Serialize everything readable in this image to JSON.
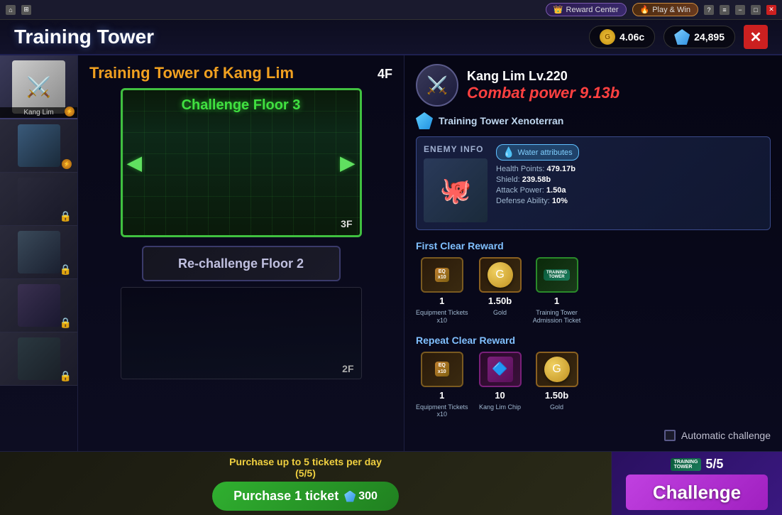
{
  "os_bar": {
    "buttons": [
      "home",
      "grid",
      "window"
    ],
    "reward_center": "Reward Center",
    "play_win": "Play & Win"
  },
  "header": {
    "title": "Training Tower",
    "currency_gold": "4.06c",
    "currency_gems": "24,895",
    "close_label": "✕"
  },
  "sidebar": {
    "hero_name": "Kang Lim"
  },
  "tower_panel": {
    "title": "Training Tower of Kang Lim",
    "floor_current": "4F",
    "challenge_floor_label": "Challenge Floor 3",
    "floor_3_label": "3F",
    "rechallenge_label": "Re-challenge Floor 2",
    "floor_2_label": "2F"
  },
  "right_panel": {
    "boss_name": "Kang Lim Lv.220",
    "combat_power": "Combat power 9.13b",
    "tower_name": "Training Tower Xenoterran",
    "enemy_info_title": "ENEMY INFO",
    "attribute": "Water attributes",
    "hp": "479.17b",
    "shield": "239.58b",
    "attack": "1.50a",
    "defense": "10%",
    "first_clear_title": "First Clear Reward",
    "repeat_clear_title": "Repeat Clear Reward",
    "rewards_first": [
      {
        "count": "1",
        "desc": "Equipment Tickets\nx10",
        "type": "equipment"
      },
      {
        "count": "1.50b",
        "desc": "Gold",
        "type": "gold"
      },
      {
        "count": "1",
        "desc": "Training Tower\nAdmission Ticket",
        "type": "training"
      }
    ],
    "rewards_repeat": [
      {
        "count": "1",
        "desc": "Equipment Tickets\nx10",
        "type": "equipment"
      },
      {
        "count": "10",
        "desc": "Kang Lim Chip",
        "type": "chip"
      },
      {
        "count": "1.50b",
        "desc": "Gold",
        "type": "gold"
      }
    ],
    "auto_challenge_label": "Automatic challenge"
  },
  "bottom": {
    "purchase_info": "Purchase up to 5 tickets per day\n(5/5)",
    "purchase_btn_line1": "Purchase 1",
    "purchase_btn_line2": "ticket",
    "gem_cost": "300",
    "ticket_count": "5/5",
    "challenge_label": "Challenge"
  }
}
